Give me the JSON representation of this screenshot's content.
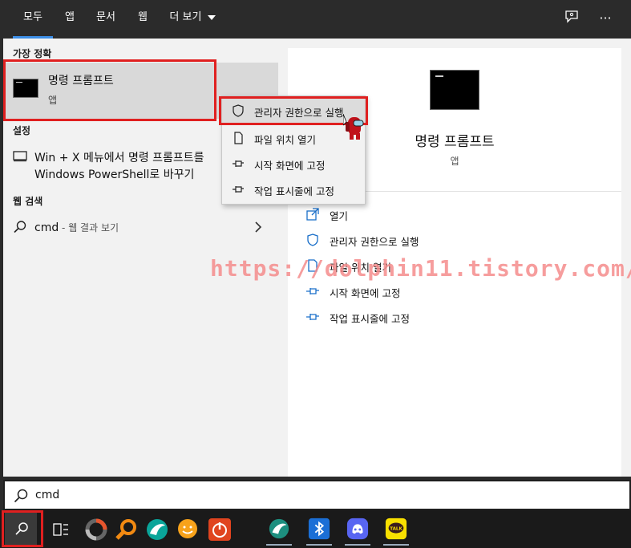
{
  "tabs": [
    {
      "label": "모두",
      "active": true
    },
    {
      "label": "앱"
    },
    {
      "label": "문서"
    },
    {
      "label": "웹"
    },
    {
      "label": "더 보기"
    }
  ],
  "topbar_icons": [
    "feedback-icon",
    "more-options-icon"
  ],
  "more_options_label": "···",
  "left": {
    "best_match_heading": "가장 정확",
    "best_match_title": "명령 프롬프트",
    "best_match_sub": "앱",
    "settings_heading": "설정",
    "settings_line1": "Win + X 메뉴에서 명령 프롬프트를",
    "settings_line2": "Windows PowerShell로 바꾸기",
    "web_heading": "웹 검색",
    "web_query": "cmd",
    "web_suffix": " - 웹 결과 보기"
  },
  "context_menu": [
    {
      "label": "관리자 권한으로 실행",
      "icon": "shield-icon"
    },
    {
      "label": "파일 위치 열기",
      "icon": "file-icon"
    },
    {
      "label": "시작 화면에 고정",
      "icon": "pin-icon"
    },
    {
      "label": "작업 표시줄에 고정",
      "icon": "pin-icon"
    }
  ],
  "right": {
    "title": "명령 프롬프트",
    "subtitle": "앱",
    "actions": [
      {
        "label": "열기",
        "icon": "open-icon"
      },
      {
        "label": "관리자 권한으로 실행",
        "icon": "shield-icon"
      },
      {
        "label": "파일 위치 열기",
        "icon": "file-icon"
      },
      {
        "label": "시작 화면에 고정",
        "icon": "pin-icon"
      },
      {
        "label": "작업 표시줄에 고정",
        "icon": "pin-icon"
      }
    ]
  },
  "watermark": "https://dolphin11.tistory.com/",
  "search": {
    "value": "cmd"
  },
  "taskbar": [
    "search-icon",
    "task-view-icon",
    "app-ring-icon",
    "magnifier-app-icon",
    "dolphin-app-icon",
    "smile-chat-icon",
    "power-app-icon",
    "dolphin-app-icon",
    "bluetooth-app-icon",
    "discord-icon",
    "kakaotalk-icon"
  ],
  "kakaotalk_label": "TALK",
  "colors": {
    "accent": "#3d8ee6",
    "highlight_red": "#e02020",
    "link_blue": "#1a6fc9"
  }
}
